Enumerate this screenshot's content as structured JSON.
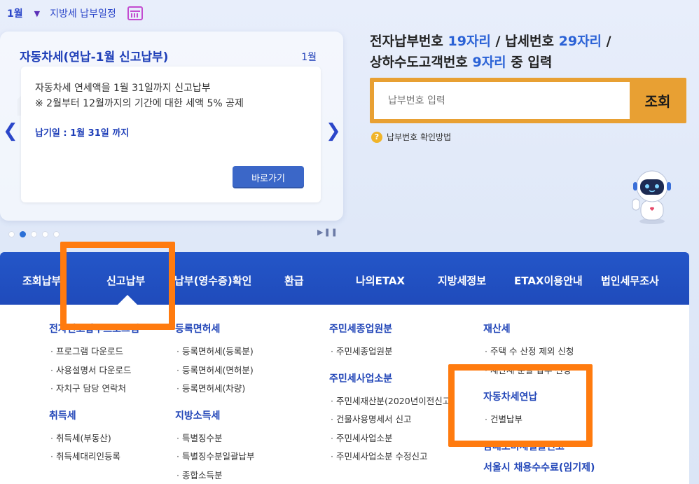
{
  "topbar": {
    "month": "1월",
    "title": "지방세 납부일정",
    "icons": [
      "chevron-down-icon",
      "calendar-icon"
    ]
  },
  "notice": {
    "title": "자동차세(연납-1월 신고납부)",
    "month": "1월",
    "line1": "자동차세 연세액을 1월 31일까지 신고납부",
    "line2": "※ 2월부터 12월까지의 기간에 대한 세액 5% 공제",
    "due": "납기일 : 1월 31일 까지",
    "button": "바로가기",
    "slides": 5,
    "active_slide": 2
  },
  "search": {
    "title_parts": [
      {
        "text": "전자납부번호 ",
        "hl": false
      },
      {
        "text": "19자리",
        "hl": true
      },
      {
        "text": " / 납세번호 ",
        "hl": false
      },
      {
        "text": "29자리",
        "hl": true
      },
      {
        "text": " /",
        "hl": false
      }
    ],
    "title_parts2": [
      {
        "text": "상하수도고객번호 ",
        "hl": false
      },
      {
        "text": "9자리",
        "hl": true
      },
      {
        "text": " 중 입력",
        "hl": false
      }
    ],
    "placeholder": "납부번호 입력",
    "button": "조회",
    "help": "납부번호 확인방법",
    "help_icon": "?",
    "accent": "#e8a033"
  },
  "nav": {
    "items": [
      "조회납부",
      "신고납부",
      "납부(영수증)확인",
      "환급",
      "나의ETAX",
      "지방세정보",
      "ETAX이용안내",
      "법인세무조사"
    ],
    "active": "신고납부",
    "color": "#2456c8"
  },
  "submenu": {
    "columns": [
      {
        "groups": [
          {
            "heading": "전자신고납부프로그램",
            "items": [
              "프로그램 다운로드",
              "사용설명서 다운로드",
              "자치구 담당 연락처"
            ]
          },
          {
            "heading": "취득세",
            "items": [
              "취득세(부동산)",
              "취득세대리인등록"
            ]
          }
        ]
      },
      {
        "groups": [
          {
            "heading": "등록면허세",
            "items": [
              "등록면허세(등록분)",
              "등록면허세(면허분)",
              "등록면허세(차량)"
            ]
          },
          {
            "heading": "지방소득세",
            "items": [
              "특별징수분",
              "특별징수분일괄납부",
              "종합소득분"
            ]
          }
        ]
      },
      {
        "groups": [
          {
            "heading": "주민세종업원분",
            "items": [
              "주민세종업원분"
            ]
          },
          {
            "heading": "주민세사업소분",
            "items": [
              "주민세재산분(2020년이전신고)",
              "건물사용명세서 신고",
              "주민세사업소분",
              "주민세사업소분 수정신고"
            ]
          }
        ]
      },
      {
        "groups": [
          {
            "heading": "재산세",
            "items": [
              "주택 수 산정 제외 신청",
              "재산세 분할 납부 신청"
            ]
          },
          {
            "heading": "자동차세연납",
            "items": [
              "건별납부"
            ]
          },
          {
            "heading": "담배소비세일괄신고",
            "items": []
          },
          {
            "heading": "서울시 채용수수료(임기제)",
            "items": []
          }
        ]
      }
    ]
  },
  "highlight_color": "#ff7b0f"
}
